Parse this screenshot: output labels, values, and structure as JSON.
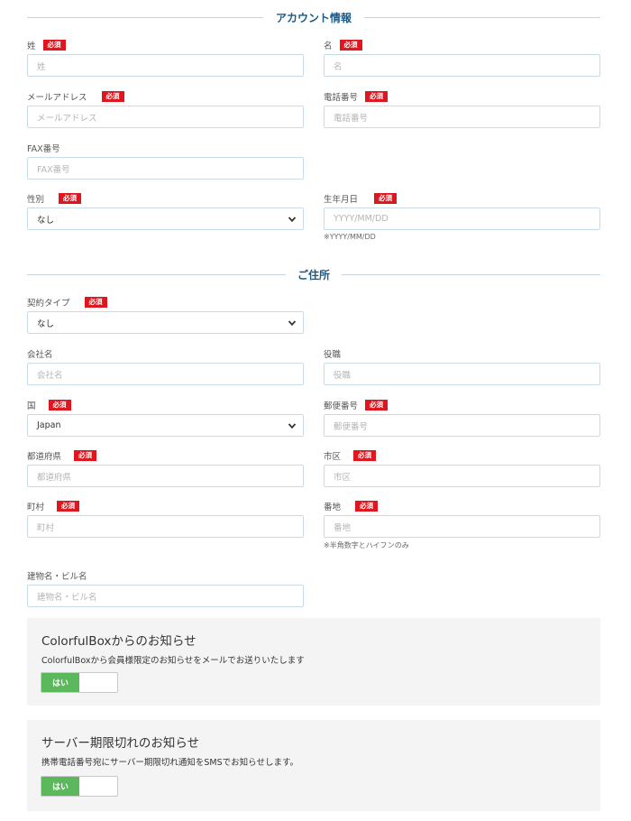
{
  "account_section": {
    "title": "アカウント情報"
  },
  "address_section": {
    "title": "ご住所"
  },
  "required_badge": "必須",
  "fields": {
    "last_name": {
      "label": "姓",
      "placeholder": "姓"
    },
    "first_name": {
      "label": "名",
      "placeholder": "名"
    },
    "email": {
      "label": "メールアドレス",
      "placeholder": "メールアドレス"
    },
    "phone": {
      "label": "電話番号",
      "placeholder": "電話番号"
    },
    "fax": {
      "label": "FAX番号",
      "placeholder": "FAX番号"
    },
    "gender": {
      "label": "性別",
      "value": "なし"
    },
    "birthdate": {
      "label": "生年月日",
      "placeholder": "YYYY/MM/DD",
      "hint": "※YYYY/MM/DD"
    },
    "contract_type": {
      "label": "契約タイプ",
      "value": "なし"
    },
    "company": {
      "label": "会社名",
      "placeholder": "会社名"
    },
    "position": {
      "label": "役職",
      "placeholder": "役職"
    },
    "country": {
      "label": "国",
      "value": "Japan"
    },
    "postal": {
      "label": "郵便番号",
      "placeholder": "郵便番号"
    },
    "prefecture": {
      "label": "都道府県",
      "placeholder": "都道府県"
    },
    "city": {
      "label": "市区",
      "placeholder": "市区"
    },
    "town": {
      "label": "町村",
      "placeholder": "町村"
    },
    "street": {
      "label": "番地",
      "placeholder": "番地",
      "hint": "※半角数字とハイフンのみ"
    },
    "building": {
      "label": "建物名・ビル名",
      "placeholder": "建物名・ビル名"
    }
  },
  "notices": [
    {
      "title": "ColorfulBoxからのお知らせ",
      "description": "ColorfulBoxから会員様限定のお知らせをメールでお送りいたします",
      "toggle_label": "はい"
    },
    {
      "title": "サーバー期限切れのお知らせ",
      "description": "携帯電話番号宛にサーバー期限切れ通知をSMSでお知らせします。",
      "toggle_label": "はい"
    }
  ],
  "colors": {
    "required": "#e0161f",
    "accent": "#1a5a86",
    "toggle_on": "#5cb85c"
  }
}
